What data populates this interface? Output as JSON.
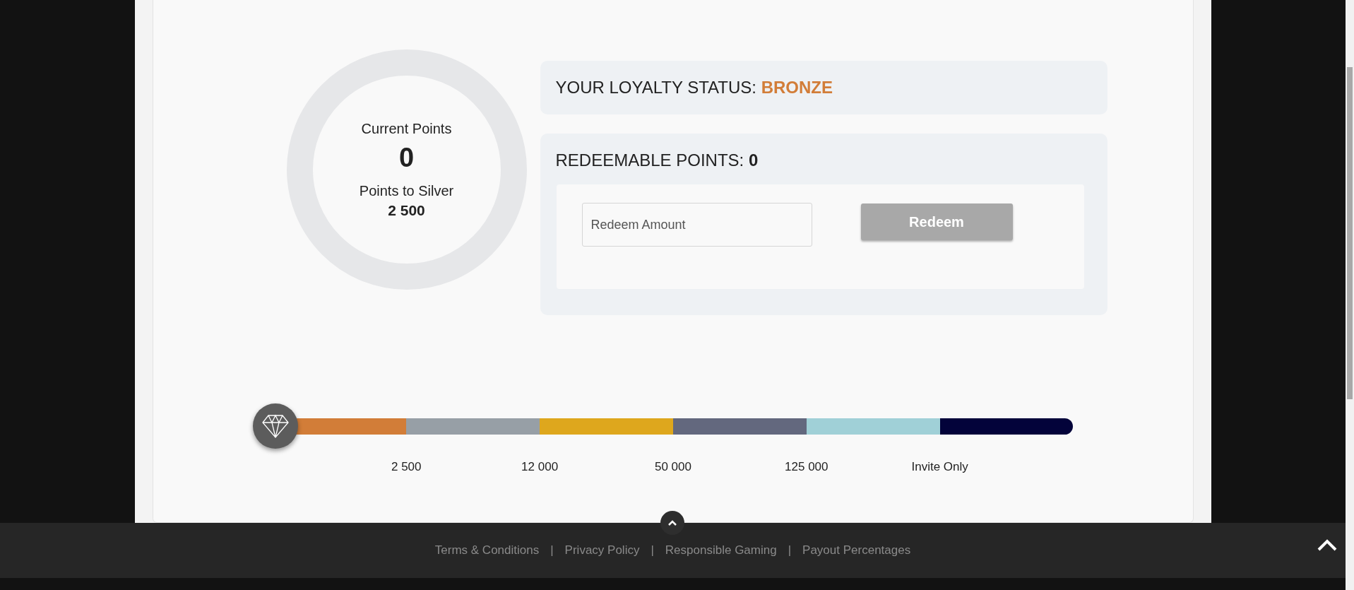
{
  "points": {
    "current_label": "Current Points",
    "current_value": "0",
    "next_label": "Points to Silver",
    "next_value": "2 500"
  },
  "status": {
    "label": "YOUR LOYALTY STATUS: ",
    "value": "BRONZE",
    "color": "#d27d38"
  },
  "redeem": {
    "label": "REDEEMABLE POINTS: ",
    "value": "0",
    "placeholder": "Redeem Amount",
    "button": "Redeem",
    "button_disabled": true
  },
  "tiers": [
    {
      "color": "#d27d38",
      "threshold": "2 500"
    },
    {
      "color": "#979fa6",
      "threshold": "12 000"
    },
    {
      "color": "#dea71d",
      "threshold": "50 000"
    },
    {
      "color": "#63687e",
      "threshold": "125 000"
    },
    {
      "color": "#a0d0d7",
      "threshold": "Invite Only"
    },
    {
      "color": "#03033a"
    }
  ],
  "footer": {
    "separator": "|",
    "links": [
      "Terms & Conditions",
      "Privacy Policy",
      "Responsible Gaming",
      "Payout Percentages"
    ]
  }
}
